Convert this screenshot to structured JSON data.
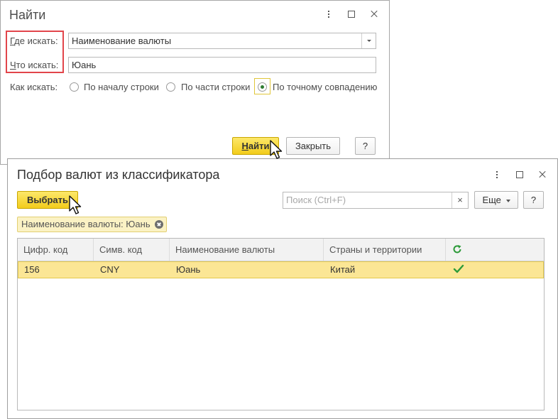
{
  "find_dialog": {
    "title": "Найти",
    "where_label_u": "Г",
    "where_label_rest": "де искать:",
    "where_value": "Наименование валюты",
    "what_label_u": "Ч",
    "what_label_rest": "то искать:",
    "what_value": "Юань",
    "how_label": "Как искать:",
    "options": [
      "По началу строки",
      "По части строки",
      "По точному совпадению"
    ],
    "selected_option": "По точному совпадению",
    "find_button_u": "Н",
    "find_button_rest": "айти",
    "close_button": "Закрыть",
    "help_button": "?"
  },
  "picker_dialog": {
    "title": "Подбор валют из классификатора",
    "select_button": "Выбрать",
    "search_placeholder": "Поиск (Ctrl+F)",
    "search_clear": "×",
    "more_button": "Еще",
    "help_button": "?",
    "filter_chip": "Наименование валюты: Юань",
    "columns": [
      "Цифр. код",
      "Симв. код",
      "Наименование валюты",
      "Страны и территории"
    ],
    "rows": [
      {
        "digital_code": "156",
        "symbol_code": "CNY",
        "name": "Юань",
        "countries": "Китай"
      }
    ]
  },
  "colors": {
    "accent_yellow": "#f2cc1b",
    "row_highlight": "#fbe695",
    "check_green": "#2e9b3a",
    "annotation_red": "#e2454b"
  }
}
